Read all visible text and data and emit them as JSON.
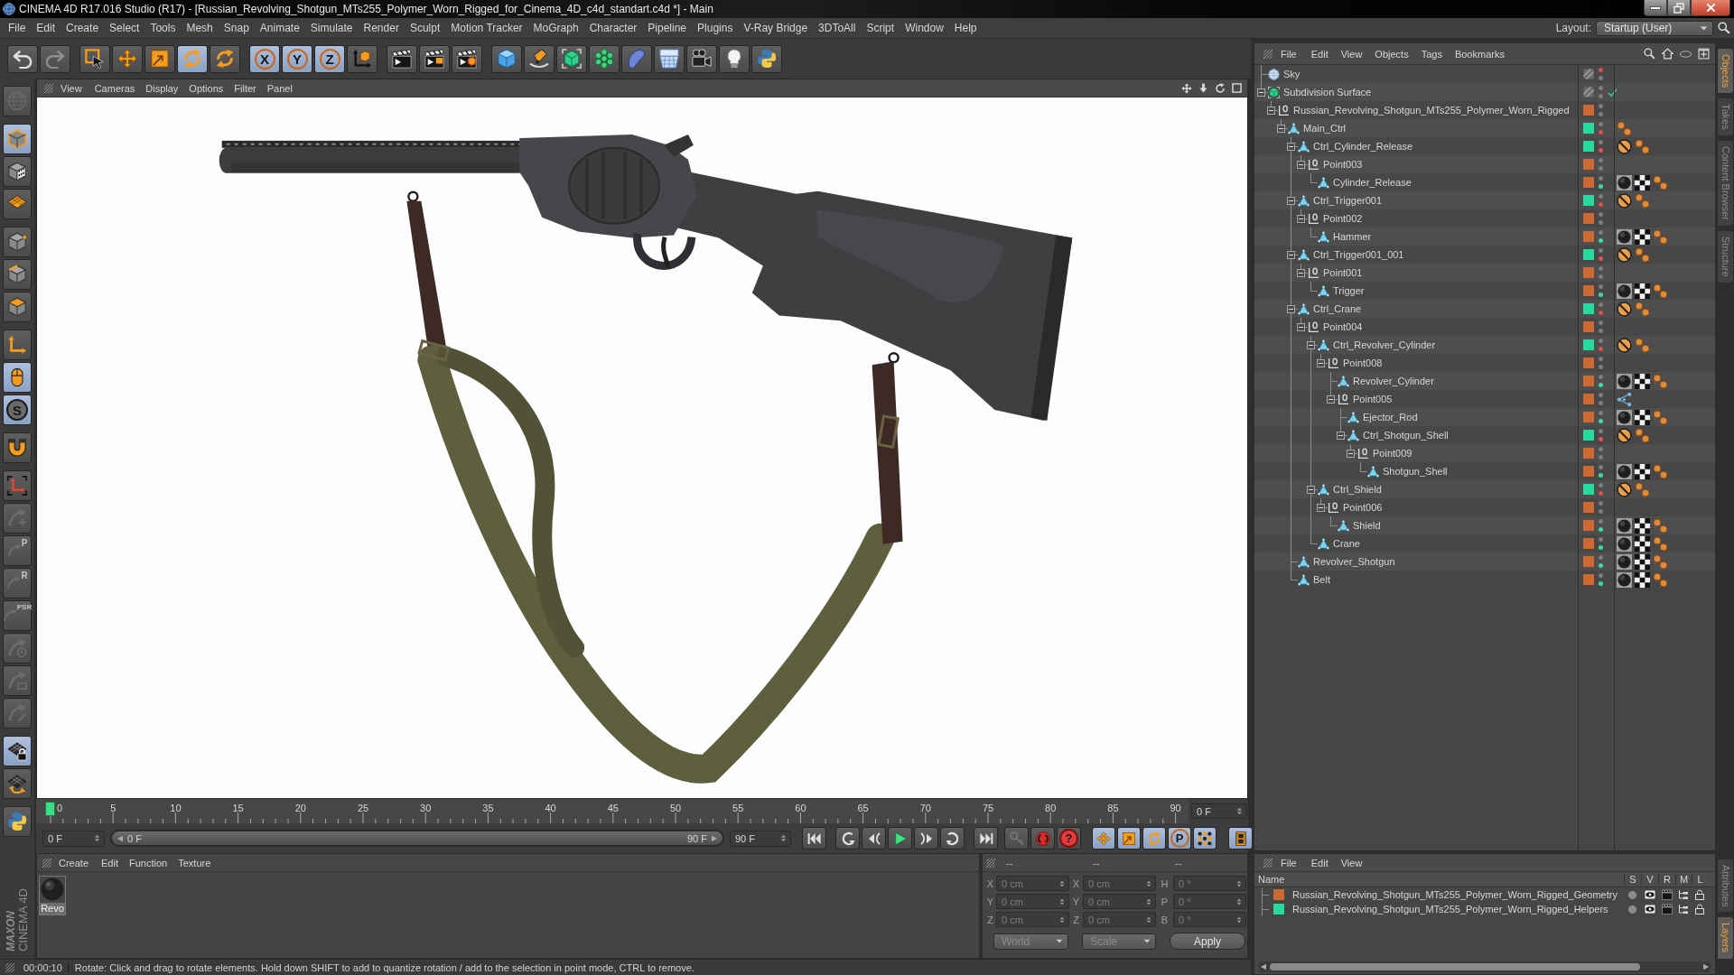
{
  "window": {
    "title": "CINEMA 4D R17.016 Studio (R17) - [Russian_Revolving_Shotgun_MTs255_Polymer_Worn_Rigged_for_Cinema_4D_c4d_standart.c4d *] - Main"
  },
  "menu_bar": {
    "items": [
      "File",
      "Edit",
      "Create",
      "Select",
      "Tools",
      "Mesh",
      "Snap",
      "Animate",
      "Simulate",
      "Render",
      "Sculpt",
      "Motion Tracker",
      "MoGraph",
      "Character",
      "Pipeline",
      "Plugins",
      "V-Ray Bridge",
      "3DToAll",
      "Script",
      "Window",
      "Help"
    ],
    "layout_label": "Layout:",
    "layout_value": "Startup (User)"
  },
  "toolbar": {
    "groups": [
      {
        "tools": [
          {
            "kind": "undo",
            "active": false,
            "disabled": false
          },
          {
            "kind": "redo",
            "active": false,
            "disabled": true
          }
        ]
      },
      {
        "tools": [
          {
            "kind": "select",
            "active": false,
            "disabled": false
          },
          {
            "kind": "move",
            "active": false,
            "disabled": false
          },
          {
            "kind": "scale",
            "active": false,
            "disabled": false
          },
          {
            "kind": "rotate",
            "active": true,
            "disabled": false
          },
          {
            "kind": "rotate",
            "active": false,
            "disabled": false
          }
        ]
      },
      {
        "tools": [
          {
            "kind": "axis_lock",
            "label": "X",
            "active": true,
            "disabled": false
          },
          {
            "kind": "axis_lock",
            "label": "Y",
            "active": true,
            "disabled": false
          },
          {
            "kind": "axis_lock",
            "label": "Z",
            "active": true,
            "disabled": false
          },
          {
            "kind": "coords",
            "active": false,
            "disabled": false
          }
        ]
      },
      {
        "tools": [
          {
            "kind": "render_view",
            "active": false,
            "disabled": false
          },
          {
            "kind": "render_picture",
            "active": false,
            "disabled": false
          },
          {
            "kind": "render_settings",
            "active": false,
            "disabled": false
          }
        ]
      },
      {
        "tools": [
          {
            "kind": "cube",
            "active": false,
            "disabled": false
          },
          {
            "kind": "pen",
            "active": false,
            "disabled": false
          },
          {
            "kind": "subdivision",
            "active": false,
            "disabled": false
          },
          {
            "kind": "cloner",
            "active": false,
            "disabled": false
          },
          {
            "kind": "deformer",
            "active": false,
            "disabled": false
          },
          {
            "kind": "floor",
            "active": false,
            "disabled": false
          },
          {
            "kind": "camera",
            "active": false,
            "disabled": false
          },
          {
            "kind": "light",
            "active": false,
            "disabled": false
          },
          {
            "kind": "python",
            "active": false,
            "disabled": false
          }
        ]
      }
    ]
  },
  "left_toolbar": {
    "groups": [
      {
        "tools": [
          {
            "kind": "globe",
            "active": false,
            "disabled": true
          }
        ]
      },
      {
        "tools": [
          {
            "kind": "model",
            "active": true,
            "disabled": false
          },
          {
            "kind": "texture",
            "active": false,
            "disabled": false
          },
          {
            "kind": "workplane",
            "active": false,
            "disabled": false
          }
        ]
      },
      {
        "tools": [
          {
            "kind": "points",
            "active": false,
            "disabled": false
          },
          {
            "kind": "edges",
            "active": false,
            "disabled": false
          },
          {
            "kind": "polygons",
            "active": false,
            "disabled": false
          }
        ]
      },
      {
        "tools": [
          {
            "kind": "axis",
            "active": false,
            "disabled": false
          },
          {
            "kind": "mouse",
            "active": true,
            "disabled": false
          },
          {
            "kind": "snap",
            "label": "S",
            "active": true,
            "disabled": false
          }
        ]
      },
      {
        "tools": [
          {
            "kind": "magnet",
            "active": false,
            "disabled": false
          }
        ]
      },
      {
        "tools": [
          {
            "kind": "axis_corners",
            "active": false,
            "disabled": false
          },
          {
            "kind": "tool_plus",
            "active": false,
            "disabled": true
          },
          {
            "kind": "tool_p",
            "label": "P",
            "active": false,
            "disabled": true
          },
          {
            "kind": "tool_r",
            "label": "R",
            "active": false,
            "disabled": true
          },
          {
            "kind": "tool_psr",
            "label": "PSR",
            "active": false,
            "disabled": true
          },
          {
            "kind": "tool_target",
            "active": false,
            "disabled": true
          },
          {
            "kind": "tool_frame",
            "active": false,
            "disabled": true
          },
          {
            "kind": "tool_pen",
            "active": false,
            "disabled": true
          }
        ]
      },
      {
        "tools": [
          {
            "kind": "grid_lock",
            "active": true,
            "disabled": false
          },
          {
            "kind": "grid_rotate",
            "active": false,
            "disabled": false
          }
        ]
      },
      {
        "tools": [
          {
            "kind": "python",
            "active": false,
            "disabled": false
          }
        ]
      }
    ]
  },
  "logo": {
    "brand": "MAXON",
    "product": "CINEMA 4D"
  },
  "viewport": {
    "menu": [
      "View",
      "Cameras",
      "Display",
      "Options",
      "Filter",
      "Panel"
    ]
  },
  "timeline": {
    "level": 0,
    "labels": [
      "0",
      "5",
      "10",
      "15",
      "20",
      "25",
      "30",
      "35",
      "40",
      "45",
      "50",
      "55",
      "60",
      "65",
      "70",
      "75",
      "80",
      "85",
      "90"
    ],
    "frame_field": "0 F"
  },
  "transport": {
    "start_field": "0 F",
    "range": {
      "start": "0 F",
      "end": "90 F",
      "level": 1
    },
    "end_field": "90 F",
    "groups": [
      {
        "tools": [
          {
            "kind": "go_start",
            "active": false,
            "disabled": false
          }
        ]
      },
      {
        "tools": [
          {
            "kind": "prev_key",
            "active": false,
            "disabled": false
          },
          {
            "kind": "prev_frame",
            "active": false,
            "disabled": false
          },
          {
            "kind": "play",
            "active": false,
            "disabled": false
          },
          {
            "kind": "next_frame",
            "active": false,
            "disabled": false
          },
          {
            "kind": "next_key",
            "active": false,
            "disabled": false
          }
        ]
      },
      {
        "tools": [
          {
            "kind": "go_end",
            "active": false,
            "disabled": false
          }
        ]
      },
      {
        "tools": [
          {
            "kind": "key",
            "active": false,
            "disabled": true
          },
          {
            "kind": "record",
            "active": false,
            "disabled": false
          },
          {
            "kind": "help",
            "label": "?",
            "active": false,
            "disabled": false
          }
        ]
      },
      {
        "tools": [
          {
            "kind": "move",
            "active": true,
            "disabled": false
          },
          {
            "kind": "scale",
            "active": true,
            "disabled": false
          },
          {
            "kind": "rotate",
            "active": true,
            "disabled": false
          },
          {
            "kind": "parameter",
            "label": "P",
            "active": true,
            "disabled": false
          },
          {
            "kind": "dots",
            "active": true,
            "disabled": false
          }
        ]
      },
      {
        "tools": [
          {
            "kind": "film",
            "active": true,
            "disabled": false
          }
        ]
      }
    ]
  },
  "material_manager": {
    "menu": [
      "Create",
      "Edit",
      "Function",
      "Texture"
    ],
    "materials": [
      {
        "name": "Revo"
      }
    ]
  },
  "coordinates": {
    "headers": [
      "--",
      "--",
      "--"
    ],
    "disabled": true,
    "rows": [
      {
        "position_axis": "X",
        "position": "0 cm",
        "size_axis": "X",
        "size": "0 cm",
        "rotation_axis": "H",
        "rotation": "0 °"
      },
      {
        "position_axis": "Y",
        "position": "0 cm",
        "size_axis": "Y",
        "size": "0 cm",
        "rotation_axis": "P",
        "rotation": "0 °"
      },
      {
        "position_axis": "Z",
        "position": "0 cm",
        "size_axis": "Z",
        "size": "0 cm",
        "rotation_axis": "B",
        "rotation": "0 °"
      }
    ],
    "mode": "World",
    "size_mode": "Scale",
    "apply": "Apply"
  },
  "object_manager": {
    "menu": [
      "File",
      "Edit",
      "View",
      "Objects",
      "Tags",
      "Bookmarks"
    ],
    "objects": [
      {
        "name": "Sky",
        "kind": "sky",
        "dots": [
          {
            "color": "#e0504a"
          },
          {
            "color": "#7c7c7c"
          }
        ]
      },
      {
        "name": "Subdivision Surface",
        "kind": "subdivision",
        "enabled": true,
        "expanded": true,
        "dots": [
          {
            "color": "#7c7c7c"
          },
          {
            "color": "#7c7c7c"
          }
        ],
        "children": [
          {
            "name": "Russian_Revolving_Shotgun_MTs255_Polymer_Worn_Rigged",
            "kind": "null",
            "color": "#cd6a31",
            "expanded": true,
            "dots": [
              {
                "color": "#7c7c7c"
              },
              {
                "color": "#7c7c7c"
              }
            ],
            "children": [
              {
                "name": "Main_Ctrl",
                "kind": "polygon",
                "color": "#25d99f",
                "expanded": true,
                "dots": [
                  {
                    "color": "#7c7c7c"
                  },
                  {
                    "color": "#e0504a"
                  }
                ],
                "tags": [
                  {
                    "kind": "phong"
                  }
                ],
                "children": [
                  {
                    "name": "Ctrl_Cylinder_Release",
                    "kind": "polygon",
                    "color": "#25d99f",
                    "expanded": true,
                    "dots": [
                      {
                        "color": "#7c7c7c"
                      },
                      {
                        "color": "#e0504a"
                      }
                    ],
                    "tags": [
                      {
                        "kind": "protection"
                      },
                      {
                        "kind": "phong"
                      }
                    ],
                    "children": [
                      {
                        "name": "Point003",
                        "kind": "null",
                        "color": "#cd6a31",
                        "expanded": true,
                        "dots": [
                          {
                            "color": "#7c7c7c"
                          },
                          {
                            "color": "#7c7c7c"
                          }
                        ],
                        "children": [
                          {
                            "name": "Cylinder_Release",
                            "kind": "polygon",
                            "color": "#cd6a31",
                            "dots": [
                              {
                                "color": "#7c7c7c"
                              },
                              {
                                "color": "#3ddc97"
                              }
                            ],
                            "tags": [
                              {
                                "kind": "material"
                              },
                              {
                                "kind": "uvw"
                              },
                              {
                                "kind": "phong"
                              }
                            ]
                          }
                        ]
                      }
                    ]
                  },
                  {
                    "name": "Ctrl_Trigger001",
                    "kind": "polygon",
                    "color": "#25d99f",
                    "expanded": true,
                    "dots": [
                      {
                        "color": "#7c7c7c"
                      },
                      {
                        "color": "#e0504a"
                      }
                    ],
                    "tags": [
                      {
                        "kind": "protection"
                      },
                      {
                        "kind": "phong"
                      }
                    ],
                    "children": [
                      {
                        "name": "Point002",
                        "kind": "null",
                        "color": "#cd6a31",
                        "expanded": true,
                        "dots": [
                          {
                            "color": "#7c7c7c"
                          },
                          {
                            "color": "#7c7c7c"
                          }
                        ],
                        "children": [
                          {
                            "name": "Hammer",
                            "kind": "polygon",
                            "color": "#cd6a31",
                            "dots": [
                              {
                                "color": "#7c7c7c"
                              },
                              {
                                "color": "#3ddc97"
                              }
                            ],
                            "tags": [
                              {
                                "kind": "material"
                              },
                              {
                                "kind": "uvw"
                              },
                              {
                                "kind": "phong"
                              }
                            ]
                          }
                        ]
                      }
                    ]
                  },
                  {
                    "name": "Ctrl_Trigger001_001",
                    "kind": "polygon",
                    "color": "#25d99f",
                    "expanded": true,
                    "dots": [
                      {
                        "color": "#7c7c7c"
                      },
                      {
                        "color": "#e0504a"
                      }
                    ],
                    "tags": [
                      {
                        "kind": "protection"
                      },
                      {
                        "kind": "phong"
                      }
                    ],
                    "children": [
                      {
                        "name": "Point001",
                        "kind": "null",
                        "color": "#cd6a31",
                        "expanded": true,
                        "dots": [
                          {
                            "color": "#7c7c7c"
                          },
                          {
                            "color": "#7c7c7c"
                          }
                        ],
                        "children": [
                          {
                            "name": "Trigger",
                            "kind": "polygon",
                            "color": "#cd6a31",
                            "dots": [
                              {
                                "color": "#7c7c7c"
                              },
                              {
                                "color": "#3ddc97"
                              }
                            ],
                            "tags": [
                              {
                                "kind": "material"
                              },
                              {
                                "kind": "uvw"
                              },
                              {
                                "kind": "phong"
                              }
                            ]
                          }
                        ]
                      }
                    ]
                  },
                  {
                    "name": "Ctrl_Crane",
                    "kind": "polygon",
                    "color": "#25d99f",
                    "expanded": true,
                    "dots": [
                      {
                        "color": "#7c7c7c"
                      },
                      {
                        "color": "#e0504a"
                      }
                    ],
                    "tags": [
                      {
                        "kind": "protection"
                      },
                      {
                        "kind": "phong"
                      }
                    ],
                    "children": [
                      {
                        "name": "Point004",
                        "kind": "null",
                        "color": "#cd6a31",
                        "expanded": true,
                        "dots": [
                          {
                            "color": "#7c7c7c"
                          },
                          {
                            "color": "#7c7c7c"
                          }
                        ],
                        "children": [
                          {
                            "name": "Ctrl_Revolver_Cylinder",
                            "kind": "polygon",
                            "color": "#25d99f",
                            "expanded": true,
                            "dots": [
                              {
                                "color": "#7c7c7c"
                              },
                              {
                                "color": "#e0504a"
                              }
                            ],
                            "tags": [
                              {
                                "kind": "protection"
                              },
                              {
                                "kind": "phong"
                              }
                            ],
                            "children": [
                              {
                                "name": "Point008",
                                "kind": "null",
                                "color": "#cd6a31",
                                "expanded": true,
                                "dots": [
                                  {
                                    "color": "#7c7c7c"
                                  },
                                  {
                                    "color": "#7c7c7c"
                                  }
                                ],
                                "children": [
                                  {
                                    "name": "Revolver_Cylinder",
                                    "kind": "polygon",
                                    "color": "#cd6a31",
                                    "dots": [
                                      {
                                        "color": "#7c7c7c"
                                      },
                                      {
                                        "color": "#3ddc97"
                                      }
                                    ],
                                    "tags": [
                                      {
                                        "kind": "material"
                                      },
                                      {
                                        "kind": "uvw"
                                      },
                                      {
                                        "kind": "phong"
                                      }
                                    ]
                                  },
                                  {
                                    "name": "Point005",
                                    "kind": "null",
                                    "color": "#cd6a31",
                                    "expanded": true,
                                    "dots": [
                                      {
                                        "color": "#7c7c7c"
                                      },
                                      {
                                        "color": "#7c7c7c"
                                      }
                                    ],
                                    "tags": [
                                      {
                                        "kind": "constraint"
                                      }
                                    ],
                                    "children": [
                                      {
                                        "name": "Ejector_Rod",
                                        "kind": "polygon",
                                        "color": "#cd6a31",
                                        "dots": [
                                          {
                                            "color": "#7c7c7c"
                                          },
                                          {
                                            "color": "#3ddc97"
                                          }
                                        ],
                                        "tags": [
                                          {
                                            "kind": "material"
                                          },
                                          {
                                            "kind": "uvw"
                                          },
                                          {
                                            "kind": "phong"
                                          }
                                        ]
                                      },
                                      {
                                        "name": "Ctrl_Shotgun_Shell",
                                        "kind": "polygon",
                                        "color": "#25d99f",
                                        "expanded": true,
                                        "dots": [
                                          {
                                            "color": "#7c7c7c"
                                          },
                                          {
                                            "color": "#e0504a"
                                          }
                                        ],
                                        "tags": [
                                          {
                                            "kind": "protection"
                                          },
                                          {
                                            "kind": "phong"
                                          }
                                        ],
                                        "children": [
                                          {
                                            "name": "Point009",
                                            "kind": "null",
                                            "color": "#cd6a31",
                                            "expanded": true,
                                            "dots": [
                                              {
                                                "color": "#7c7c7c"
                                              },
                                              {
                                                "color": "#7c7c7c"
                                              }
                                            ],
                                            "children": [
                                              {
                                                "name": "Shotgun_Shell",
                                                "kind": "polygon",
                                                "color": "#cd6a31",
                                                "dots": [
                                                  {
                                                    "color": "#7c7c7c"
                                                  },
                                                  {
                                                    "color": "#3ddc97"
                                                  }
                                                ],
                                                "tags": [
                                                  {
                                                    "kind": "material"
                                                  },
                                                  {
                                                    "kind": "uvw"
                                                  },
                                                  {
                                                    "kind": "phong"
                                                  }
                                                ]
                                              }
                                            ]
                                          }
                                        ]
                                      }
                                    ]
                                  }
                                ]
                              }
                            ]
                          },
                          {
                            "name": "Ctrl_Shield",
                            "kind": "polygon",
                            "color": "#25d99f",
                            "expanded": true,
                            "dots": [
                              {
                                "color": "#7c7c7c"
                              },
                              {
                                "color": "#e0504a"
                              }
                            ],
                            "tags": [
                              {
                                "kind": "protection"
                              },
                              {
                                "kind": "phong"
                              }
                            ],
                            "children": [
                              {
                                "name": "Point006",
                                "kind": "null",
                                "color": "#cd6a31",
                                "expanded": true,
                                "dots": [
                                  {
                                    "color": "#7c7c7c"
                                  },
                                  {
                                    "color": "#7c7c7c"
                                  }
                                ],
                                "children": [
                                  {
                                    "name": "Shield",
                                    "kind": "polygon",
                                    "color": "#cd6a31",
                                    "dots": [
                                      {
                                        "color": "#7c7c7c"
                                      },
                                      {
                                        "color": "#3ddc97"
                                      }
                                    ],
                                    "tags": [
                                      {
                                        "kind": "material"
                                      },
                                      {
                                        "kind": "uvw"
                                      },
                                      {
                                        "kind": "phong"
                                      }
                                    ]
                                  }
                                ]
                              }
                            ]
                          },
                          {
                            "name": "Crane",
                            "kind": "polygon",
                            "color": "#cd6a31",
                            "dots": [
                              {
                                "color": "#7c7c7c"
                              },
                              {
                                "color": "#3ddc97"
                              }
                            ],
                            "tags": [
                              {
                                "kind": "material"
                              },
                              {
                                "kind": "uvw"
                              },
                              {
                                "kind": "phong"
                              }
                            ]
                          }
                        ]
                      }
                    ]
                  },
                  {
                    "name": "Revolver_Shotgun",
                    "kind": "polygon",
                    "color": "#cd6a31",
                    "dots": [
                      {
                        "color": "#7c7c7c"
                      },
                      {
                        "color": "#3ddc97"
                      }
                    ],
                    "tags": [
                      {
                        "kind": "material"
                      },
                      {
                        "kind": "uvw"
                      },
                      {
                        "kind": "phong"
                      }
                    ]
                  },
                  {
                    "name": "Belt",
                    "kind": "polygon",
                    "color": "#cd6a31",
                    "dots": [
                      {
                        "color": "#7c7c7c"
                      },
                      {
                        "color": "#3ddc97"
                      }
                    ],
                    "tags": [
                      {
                        "kind": "material"
                      },
                      {
                        "kind": "uvw"
                      },
                      {
                        "kind": "phong"
                      }
                    ]
                  }
                ]
              }
            ]
          }
        ]
      }
    ]
  },
  "object_side_tabs": [
    {
      "label": "Objects",
      "selected": true
    },
    {
      "label": "Takes",
      "selected": false
    },
    {
      "label": "Content Browser",
      "selected": false
    },
    {
      "label": "Structure",
      "selected": false
    }
  ],
  "layer_manager": {
    "menu": [
      "File",
      "Edit",
      "View"
    ],
    "columns": [
      "Name",
      "S",
      "V",
      "R",
      "M",
      "L"
    ],
    "layers": [
      {
        "name": "Russian_Revolving_Shotgun_MTs255_Polymer_Worn_Rigged_Geometry",
        "color": "#cd6a31"
      },
      {
        "name": "Russian_Revolving_Shotgun_MTs255_Polymer_Worn_Rigged_Helpers",
        "color": "#25d99f"
      }
    ]
  },
  "layer_side_tabs": [
    {
      "label": "Attributes",
      "selected": false
    },
    {
      "label": "Layers",
      "selected": true
    }
  ],
  "status_bar": {
    "time": "00:00:10",
    "message": "Rotate: Click and drag to rotate elements. Hold down SHIFT to add to quantize rotation / add to the selection in point mode, CTRL to remove."
  }
}
